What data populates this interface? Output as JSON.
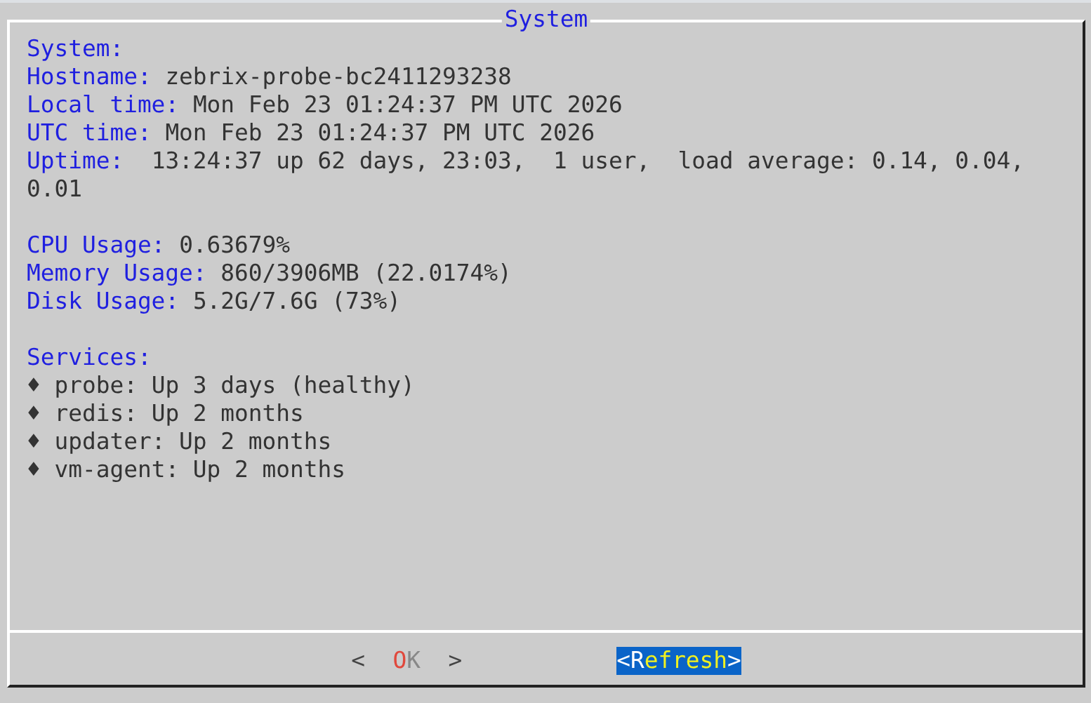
{
  "dialog": {
    "title": "System",
    "sections": [
      {
        "heading": "System:",
        "fields": [
          {
            "label": "Hostname:",
            "value": "zebrix-probe-bc2411293238"
          },
          {
            "label": "Local time:",
            "value": "Mon Feb 23 01:24:37 PM UTC 2026"
          },
          {
            "label": "UTC time:",
            "value": "Mon Feb 23 01:24:37 PM UTC 2026"
          },
          {
            "label": "Uptime:",
            "value": " 13:24:37 up 62 days, 23:03,  1 user,  load average: 0.14, 0.04, 0.01"
          }
        ]
      },
      {
        "fields": [
          {
            "label": "CPU Usage:",
            "value": "0.63679%"
          },
          {
            "label": "Memory Usage:",
            "value": "860/3906MB (22.0174%)"
          },
          {
            "label": "Disk Usage:",
            "value": "5.2G/7.6G (73%)"
          }
        ]
      },
      {
        "heading": "Services:",
        "items": [
          {
            "bullet": "♦",
            "text": "probe: Up 3 days (healthy)"
          },
          {
            "bullet": "♦",
            "text": "redis: Up 2 months"
          },
          {
            "bullet": "♦",
            "text": "updater: Up 2 months"
          },
          {
            "bullet": "♦",
            "text": "vm-agent: Up 2 months"
          }
        ]
      }
    ],
    "buttons": [
      {
        "open": "<",
        "label": "OK",
        "close": ">",
        "selected": false
      },
      {
        "open": "<",
        "label": "Refresh",
        "close": ">",
        "selected": true
      }
    ]
  }
}
